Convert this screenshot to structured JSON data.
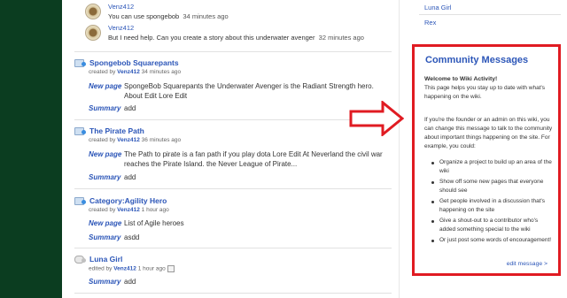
{
  "replies": [
    {
      "author": "Venz412",
      "text": "You can use spongebob",
      "time": "34 minutes ago"
    },
    {
      "author": "Venz412",
      "text": "But I need help. Can you create a story about this underwater avenger",
      "time": "32 minutes ago"
    }
  ],
  "entries": [
    {
      "title": "Spongebob Squarepants",
      "action": "created by",
      "user": "Venz412",
      "time": "34 minutes ago",
      "label1": "New page",
      "value1": "SpongeBob Squarepants the Underwater Avenger is the Radiant Strength hero. About Edit Lore Edit",
      "label2": "Summary",
      "value2": "add"
    },
    {
      "title": "The Pirate Path",
      "action": "created by",
      "user": "Venz412",
      "time": "36 minutes ago",
      "label1": "New page",
      "value1": "The Path to pirate is a fan path if you play dota Lore Edit At Neverland the civil war reaches the Pirate Island. the Never League of Pirate...",
      "label2": "Summary",
      "value2": "add"
    },
    {
      "title": "Category:Agility Hero",
      "action": "created by",
      "user": "Venz412",
      "time": "1 hour ago",
      "label1": "New page",
      "value1": "List of Agile heroes",
      "label2": "Summary",
      "value2": "asdd"
    },
    {
      "title": "Luna Girl",
      "action": "edited by",
      "user": "Venz412",
      "time": "1 hour ago",
      "label2": "Summary",
      "value2": "add"
    }
  ],
  "right_links": [
    "Luna Girl",
    "Rex"
  ],
  "community": {
    "title": "Community Messages",
    "welcome": "Welcome to Wiki Activity!",
    "intro": "This page helps you stay up to date with what's happening on the wiki.",
    "founder_text": "If you're the founder or an admin on this wiki, you can change this message to talk to the community about important things happening on the site. For example, you could:",
    "bullets": [
      "Organize a project to build up an area of the wiki",
      "Show off some new pages that everyone should see",
      "Get people involved in a discussion that's happening on the site",
      "Give a shout-out to a contributor who's added something special to the wiki",
      "Or just post some words of encouragement!"
    ],
    "edit_link": "edit message >"
  },
  "colors": {
    "link": "#2c56b8",
    "highlight": "#e01b22",
    "sidebar_bg": "#0b3d20"
  }
}
